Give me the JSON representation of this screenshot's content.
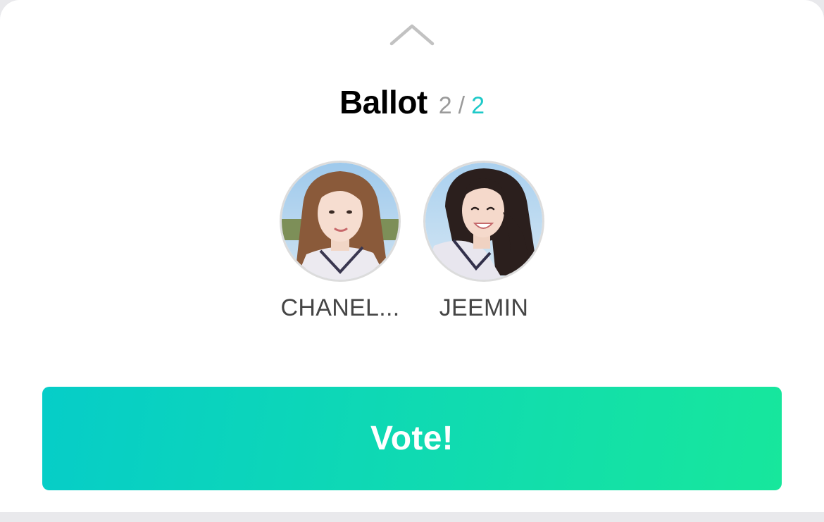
{
  "ballot": {
    "title": "Ballot",
    "current": "2",
    "separator": "/",
    "total": "2"
  },
  "candidates": [
    {
      "name": "CHANEL...",
      "icon": "avatar-photo"
    },
    {
      "name": "JEEMIN",
      "icon": "avatar-photo"
    }
  ],
  "actions": {
    "vote_label": "Vote!"
  },
  "colors": {
    "accent": "#1ec9c8",
    "button_start": "#06cdc8",
    "button_end": "#17e79c"
  }
}
